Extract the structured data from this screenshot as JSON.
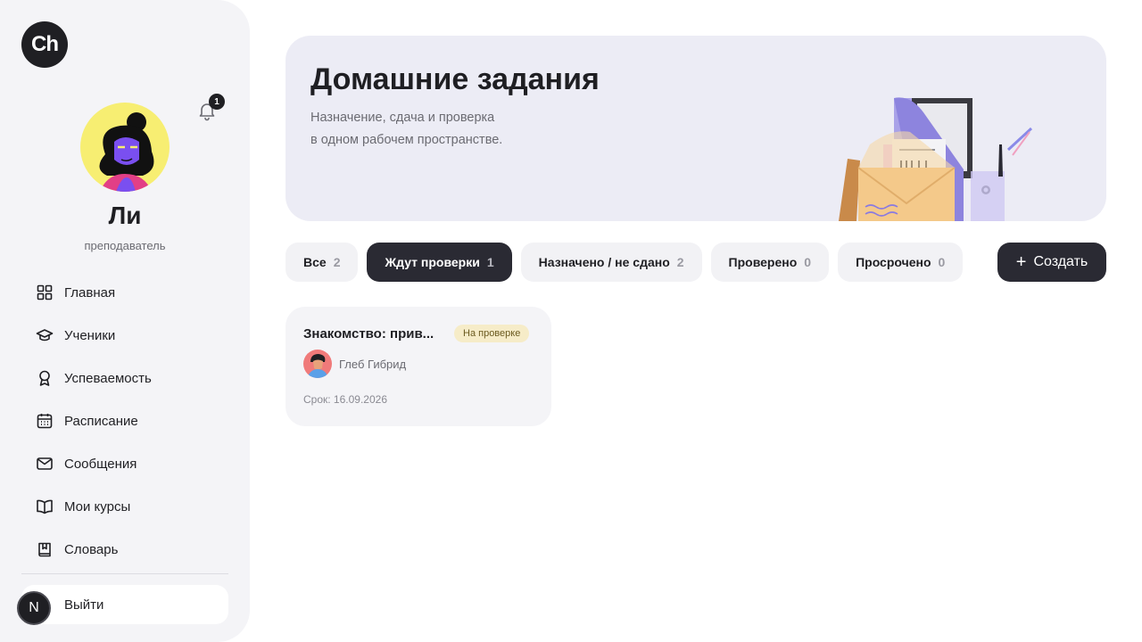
{
  "app": {
    "logo_text": "Ch"
  },
  "notifications": {
    "count": "1"
  },
  "user": {
    "name": "Ли",
    "role": "преподаватель"
  },
  "nav": {
    "items": [
      {
        "label": "Главная",
        "icon": "grid-icon"
      },
      {
        "label": "Ученики",
        "icon": "graduation-cap-icon"
      },
      {
        "label": "Успеваемость",
        "icon": "award-icon"
      },
      {
        "label": "Расписание",
        "icon": "calendar-icon"
      },
      {
        "label": "Сообщения",
        "icon": "mail-icon"
      },
      {
        "label": "Мои курсы",
        "icon": "book-open-icon"
      },
      {
        "label": "Словарь",
        "icon": "bookmark-book-icon"
      }
    ],
    "logout_label": "Выйти",
    "n_badge": "N"
  },
  "hero": {
    "title": "Домашние задания",
    "subtitle_line1": "Назначение, сдача и проверка",
    "subtitle_line2": "в одном рабочем пространстве."
  },
  "filters": [
    {
      "label": "Все",
      "count": "2",
      "active": false
    },
    {
      "label": "Ждут проверки",
      "count": "1",
      "active": true
    },
    {
      "label": "Назначено / не сдано",
      "count": "2",
      "active": false
    },
    {
      "label": "Проверено",
      "count": "0",
      "active": false
    },
    {
      "label": "Просрочено",
      "count": "0",
      "active": false
    }
  ],
  "create_button": {
    "label": "Создать"
  },
  "assignments": [
    {
      "title": "Знакомство: прив...",
      "status": "На проверке",
      "student": "Глеб Гибрид",
      "due": "Срок: 16.09.2026"
    }
  ],
  "colors": {
    "sidebar_bg": "#f4f4f7",
    "hero_bg": "#ececf5",
    "dark": "#2a2a33",
    "status_bg": "#f6ecc8"
  }
}
